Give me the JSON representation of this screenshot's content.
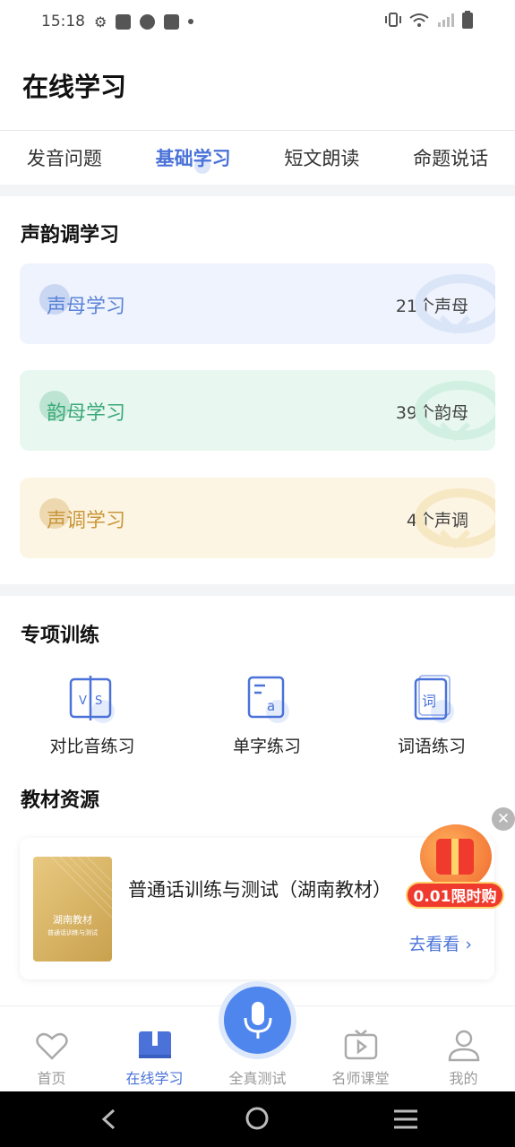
{
  "status_bar": {
    "time": "15:18"
  },
  "header": {
    "title": "在线学习"
  },
  "tabs": [
    {
      "label": "发音问题",
      "active": false
    },
    {
      "label": "基础学习",
      "active": true
    },
    {
      "label": "短文朗读",
      "active": false
    },
    {
      "label": "命题说话",
      "active": false
    }
  ],
  "tone_section": {
    "title": "声韵调学习",
    "cards": [
      {
        "label": "声母学习",
        "count": "21个声母",
        "color": "#5b83d8",
        "bg": "#eef3fd"
      },
      {
        "label": "韵母学习",
        "count": "39个韵母",
        "color": "#3aa978",
        "bg": "#e8f8f1"
      },
      {
        "label": "声调学习",
        "count": "4个声调",
        "color": "#c9963a",
        "bg": "#fdf5e3"
      }
    ]
  },
  "training_section": {
    "title": "专项训练",
    "items": [
      {
        "label": "对比音练习",
        "icon": "vs-icon",
        "glyph": "V S"
      },
      {
        "label": "单字练习",
        "icon": "single-char-icon",
        "glyph": "a"
      },
      {
        "label": "词语练习",
        "icon": "word-icon",
        "glyph": "词"
      }
    ]
  },
  "materials_section": {
    "title": "教材资源",
    "book": {
      "title": "普通话训练与测试（湖南教材）",
      "cover_title": "湖南教材",
      "cover_subtitle": "普通话训练与测试",
      "link": "去看看 ›"
    }
  },
  "promo": {
    "label": "0.01限时购"
  },
  "tabbar": [
    {
      "label": "首页",
      "icon": "heart-icon",
      "active": false
    },
    {
      "label": "在线学习",
      "icon": "book-icon",
      "active": true
    },
    {
      "label": "全真测试",
      "icon": "mic-icon",
      "active": false
    },
    {
      "label": "名师课堂",
      "icon": "tv-icon",
      "active": false
    },
    {
      "label": "我的",
      "icon": "person-icon",
      "active": false
    }
  ],
  "colors": {
    "accent": "#4a72d8",
    "mic": "#4f86ee",
    "promo": "#ef3a2d"
  }
}
